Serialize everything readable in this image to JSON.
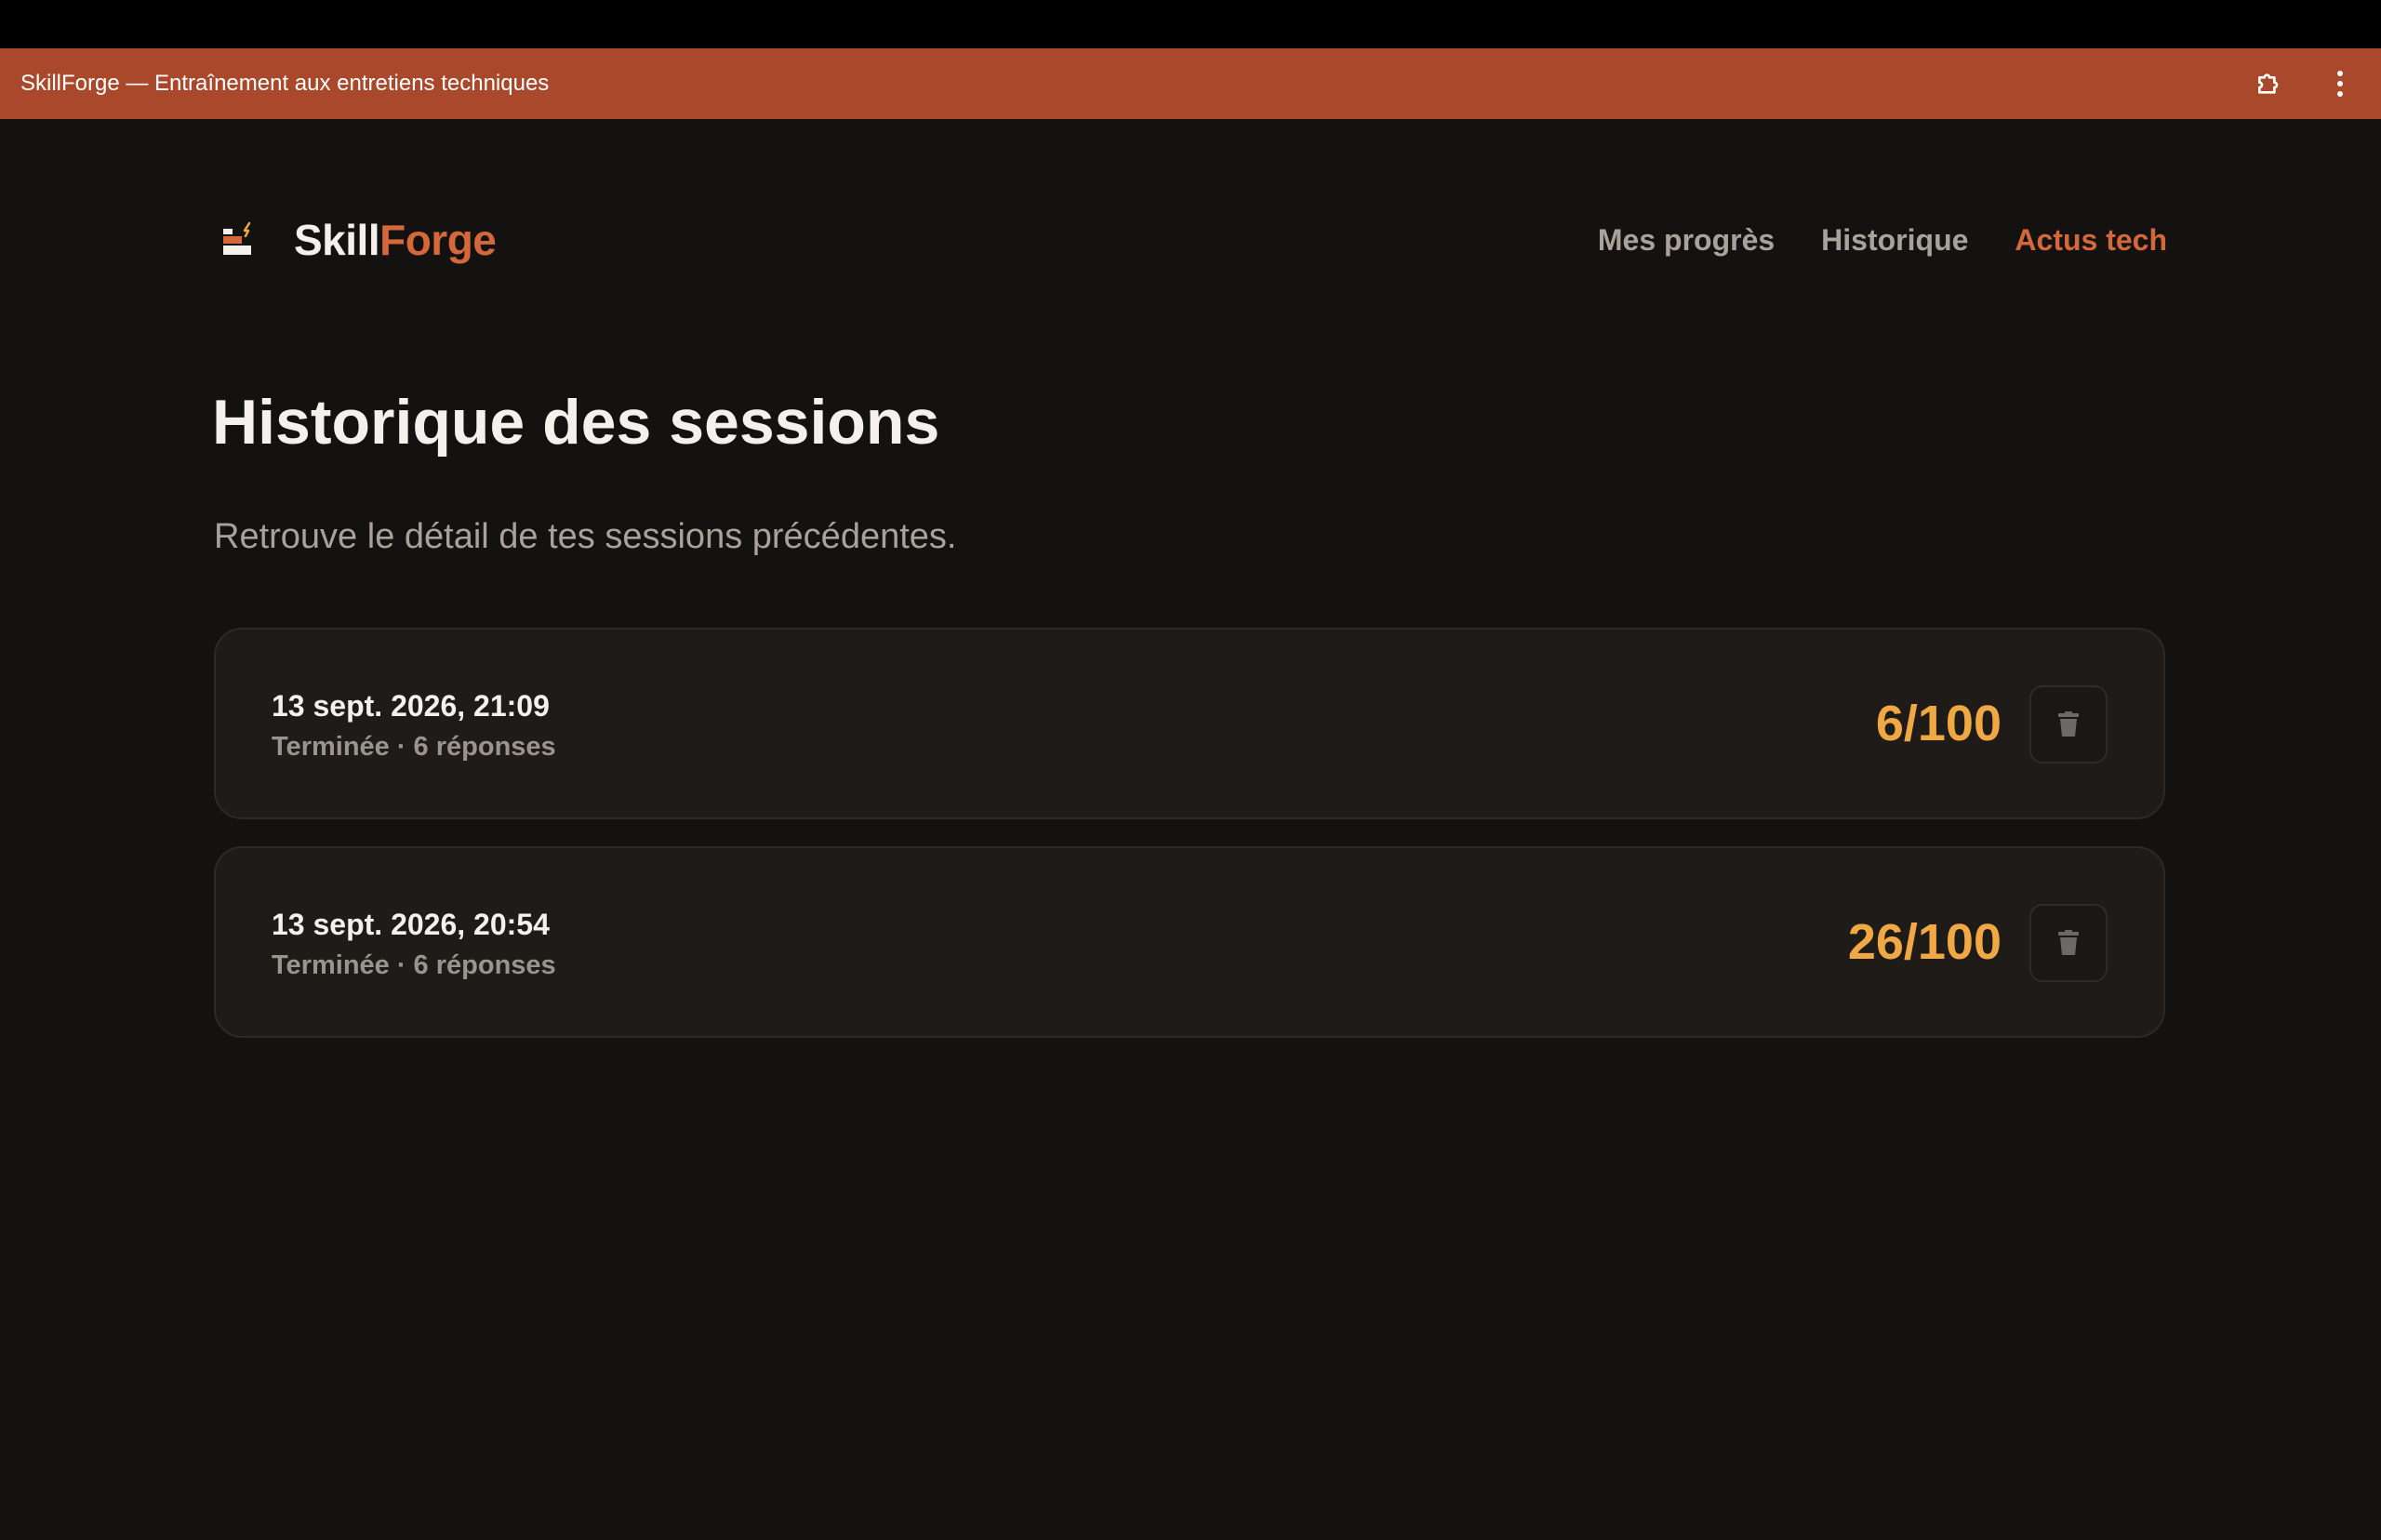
{
  "window": {
    "title": "SkillForge — Entraînement aux entretiens techniques"
  },
  "brand": {
    "name_part1": "Skill",
    "name_part2": "Forge"
  },
  "nav": [
    {
      "label": "Mes progrès",
      "active": false
    },
    {
      "label": "Historique",
      "active": false
    },
    {
      "label": "Actus tech",
      "active": true
    }
  ],
  "page": {
    "title": "Historique des sessions",
    "subtitle": "Retrouve le détail de tes sessions précédentes."
  },
  "sessions": [
    {
      "date": "13 sept. 2026, 21:09",
      "meta": "Terminée · 6 réponses",
      "score": "6/100"
    },
    {
      "date": "13 sept. 2026, 20:54",
      "meta": "Terminée · 6 réponses",
      "score": "26/100"
    }
  ],
  "colors": {
    "titlebar": "#a9482a",
    "background": "#131210",
    "accent": "#d4683a",
    "score": "#f0a844"
  },
  "icons": {
    "titlebar": [
      "extensions-icon",
      "more-vertical-icon"
    ],
    "card_action": "trash-icon"
  }
}
